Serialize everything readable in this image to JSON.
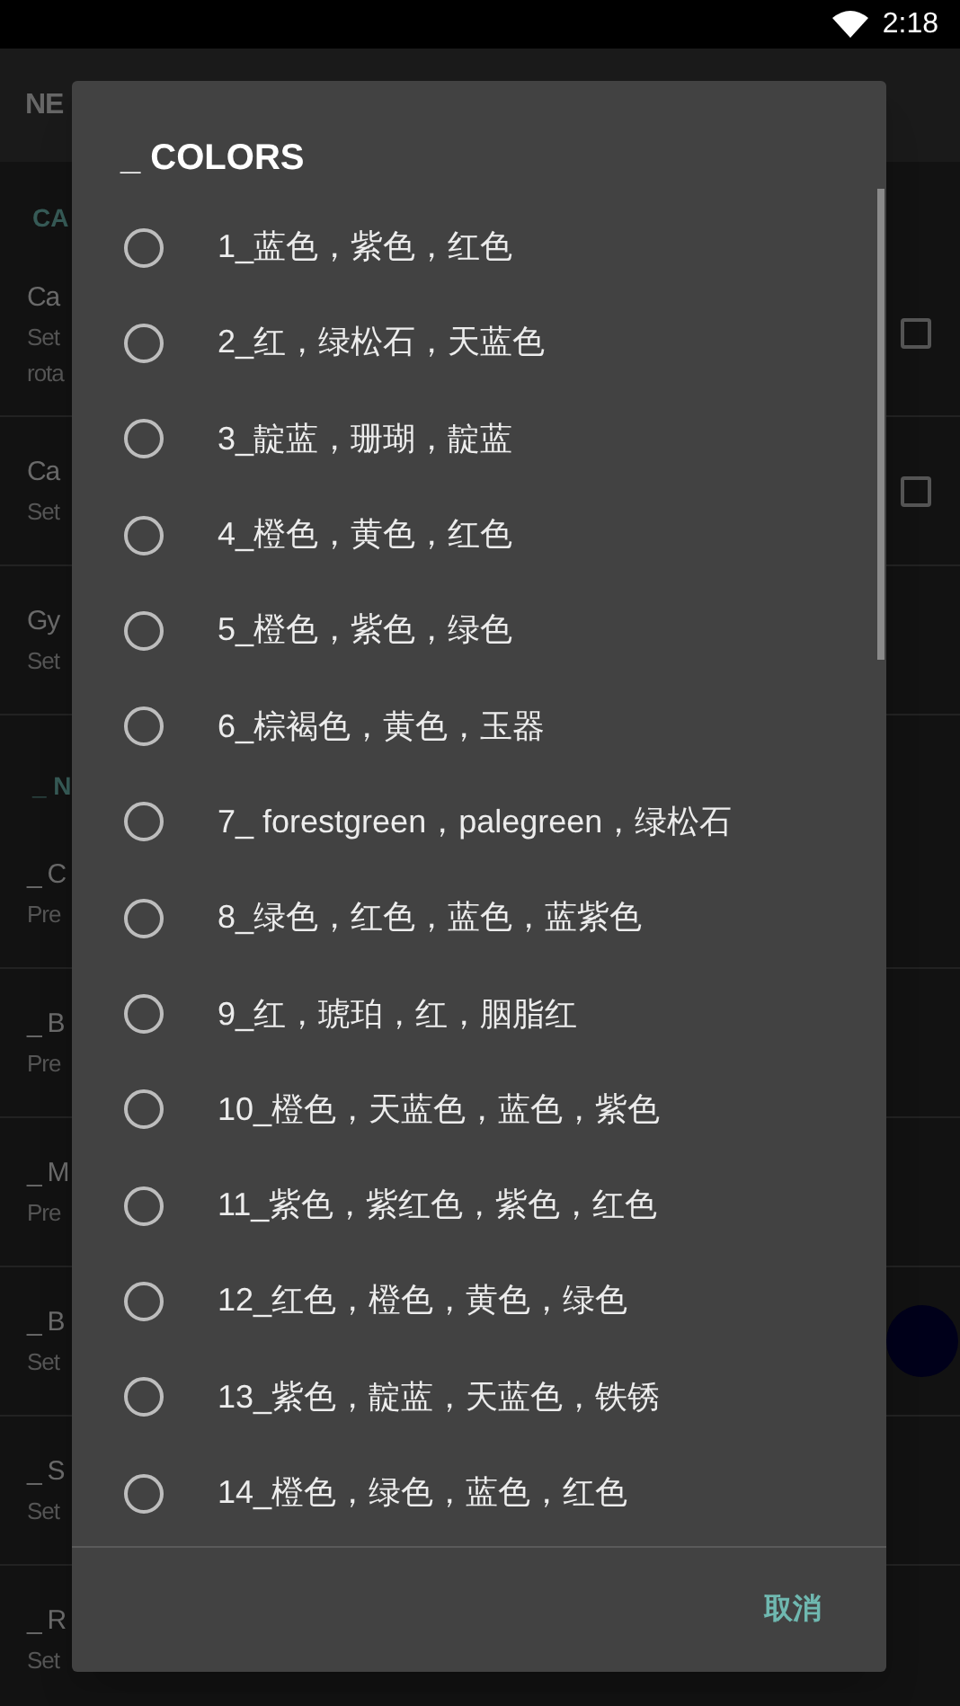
{
  "status_bar": {
    "time": "2:18"
  },
  "app_bar": {
    "title": "NE"
  },
  "sections": [
    {
      "header": "CA",
      "items": [
        {
          "title": "Ca",
          "subtitle": "Set\nrota",
          "checked": false
        },
        {
          "title": "Ca",
          "subtitle": "Set",
          "checked": false
        },
        {
          "title": "Gy",
          "subtitle": "Set"
        }
      ]
    },
    {
      "header": "_ N",
      "items": [
        {
          "title": "_ C",
          "subtitle": "Pre"
        },
        {
          "title": "_ B",
          "subtitle": "Pre"
        },
        {
          "title": "_ M",
          "subtitle": "Pre"
        },
        {
          "title": "_ B",
          "subtitle": "Set",
          "color": "#00001a"
        },
        {
          "title": "_ S",
          "subtitle": "Set"
        },
        {
          "title": "_ R",
          "subtitle": "Set"
        }
      ]
    }
  ],
  "dialog": {
    "title": "_ COLORS",
    "options": [
      {
        "label": "1_蓝色，紫色，红色",
        "selected": false
      },
      {
        "label": "2_红，绿松石，天蓝色",
        "selected": false
      },
      {
        "label": "3_靛蓝，珊瑚，靛蓝",
        "selected": false
      },
      {
        "label": "4_橙色，黄色，红色",
        "selected": false
      },
      {
        "label": "5_橙色，紫色，绿色",
        "selected": false
      },
      {
        "label": "6_棕褐色，黄色，玉器",
        "selected": false
      },
      {
        "label": "7_ forestgreen，palegreen，绿松石",
        "selected": false
      },
      {
        "label": "8_绿色，红色，蓝色，蓝紫色",
        "selected": false
      },
      {
        "label": "9_红，琥珀，红，胭脂红",
        "selected": false
      },
      {
        "label": "10_橙色，天蓝色，蓝色，紫色",
        "selected": false
      },
      {
        "label": "11_紫色，紫红色，紫色，红色",
        "selected": false
      },
      {
        "label": "12_红色，橙色，黄色，绿色",
        "selected": false
      },
      {
        "label": "13_紫色，靛蓝，天蓝色，铁锈",
        "selected": false
      },
      {
        "label": "14_橙色，绿色，蓝色，红色",
        "selected": false
      }
    ],
    "button": "取消"
  }
}
